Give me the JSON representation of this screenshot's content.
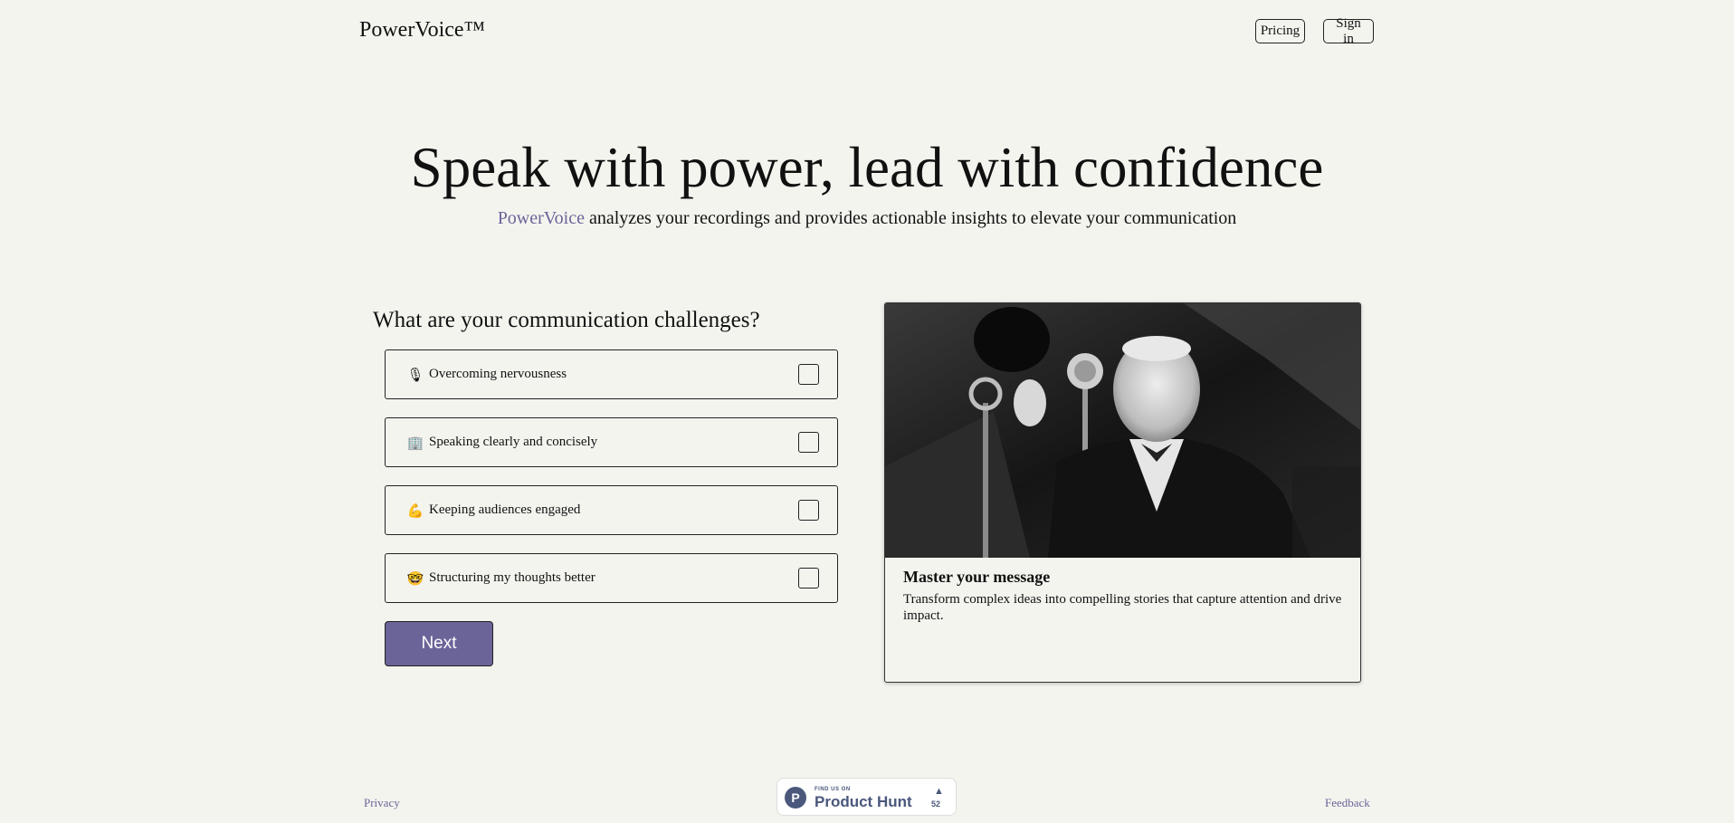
{
  "header": {
    "brand": "PowerVoice™",
    "nav": {
      "pricing": "Pricing",
      "sign_in": "Sign in"
    }
  },
  "hero": {
    "title": "Speak with power, lead with confidence",
    "subtitle_accent": "PowerVoice",
    "subtitle_rest": " analyzes your recordings and provides actionable insights to elevate your communication"
  },
  "questionnaire": {
    "title": "What are your communication challenges?",
    "options": [
      {
        "emoji": "🎙",
        "label": "Overcoming nervousness",
        "checked": false
      },
      {
        "emoji": "🏢",
        "label": "Speaking clearly and concisely",
        "checked": false
      },
      {
        "emoji": "💪",
        "label": "Keeping audiences engaged",
        "checked": false
      },
      {
        "emoji": "🤓",
        "label": "Structuring my thoughts better",
        "checked": false
      }
    ],
    "next_label": "Next"
  },
  "card": {
    "title": "Master your message",
    "description": "Transform complex ideas into compelling stories that capture attention and drive impact."
  },
  "footer": {
    "privacy": "Privacy",
    "feedback": "Feedback",
    "product_hunt": {
      "small": "FIND US ON",
      "name": "Product Hunt",
      "logo_letter": "P",
      "arrow": "▲",
      "count": "52"
    }
  },
  "colors": {
    "background": "#f4f4ef",
    "accent": "#6b6499",
    "product_hunt": "#4b587c"
  }
}
